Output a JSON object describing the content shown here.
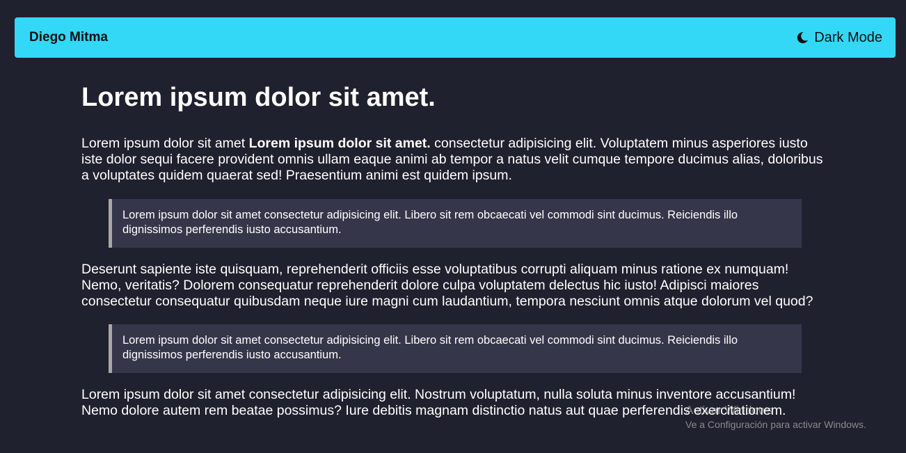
{
  "navbar": {
    "brand": "Diego Mitma",
    "dark_mode_label": "Dark Mode",
    "dark_mode_icon": "moon-icon",
    "background": "#33d8f7"
  },
  "article": {
    "title": "Lorem ipsum dolor sit amet.",
    "paragraph1": {
      "lead": "Lorem ipsum dolor sit amet ",
      "bold": "Lorem ipsum dolor sit amet.",
      "rest": " consectetur adipisicing elit. Voluptatem minus asperiores iusto iste dolor sequi facere provident omnis ullam eaque animi ab tempor a natus velit cumque tempore ducimus alias, doloribus a voluptates quidem quaerat sed! Praesentium animi est quidem ipsum."
    },
    "quote1": "Lorem ipsum dolor sit amet consectetur adipisicing elit. Libero sit rem obcaecati vel commodi sint ducimus. Reiciendis illo dignissimos perferendis iusto accusantium.",
    "paragraph2": "Deserunt sapiente iste quisquam, reprehenderit officiis esse voluptatibus corrupti aliquam minus ratione ex numquam! Nemo, veritatis? Dolorem consequatur reprehenderit dolore culpa voluptatem delectus hic iusto! Adipisci maiores consectetur consequatur quibusdam neque iure magni cum laudantium, tempora nesciunt omnis atque dolorum vel quod?",
    "quote2": "Lorem ipsum dolor sit amet consectetur adipisicing elit. Libero sit rem obcaecati vel commodi sint ducimus. Reiciendis illo dignissimos perferendis iusto accusantium.",
    "paragraph3": "Lorem ipsum dolor sit amet consectetur adipisicing elit. Nostrum voluptatum, nulla soluta minus inventore accusantium! Nemo dolore autem rem beatae possimus? Iure debitis magnam distinctio natus aut quae perferendis exercitationem."
  },
  "watermark": {
    "title": "Activar Windows",
    "subtitle": "Ve a Configuración para activar Windows."
  },
  "colors": {
    "page_background": "#20212e",
    "blockquote_background": "#353649",
    "blockquote_border": "#a8a8ab",
    "text": "#ffffff"
  }
}
